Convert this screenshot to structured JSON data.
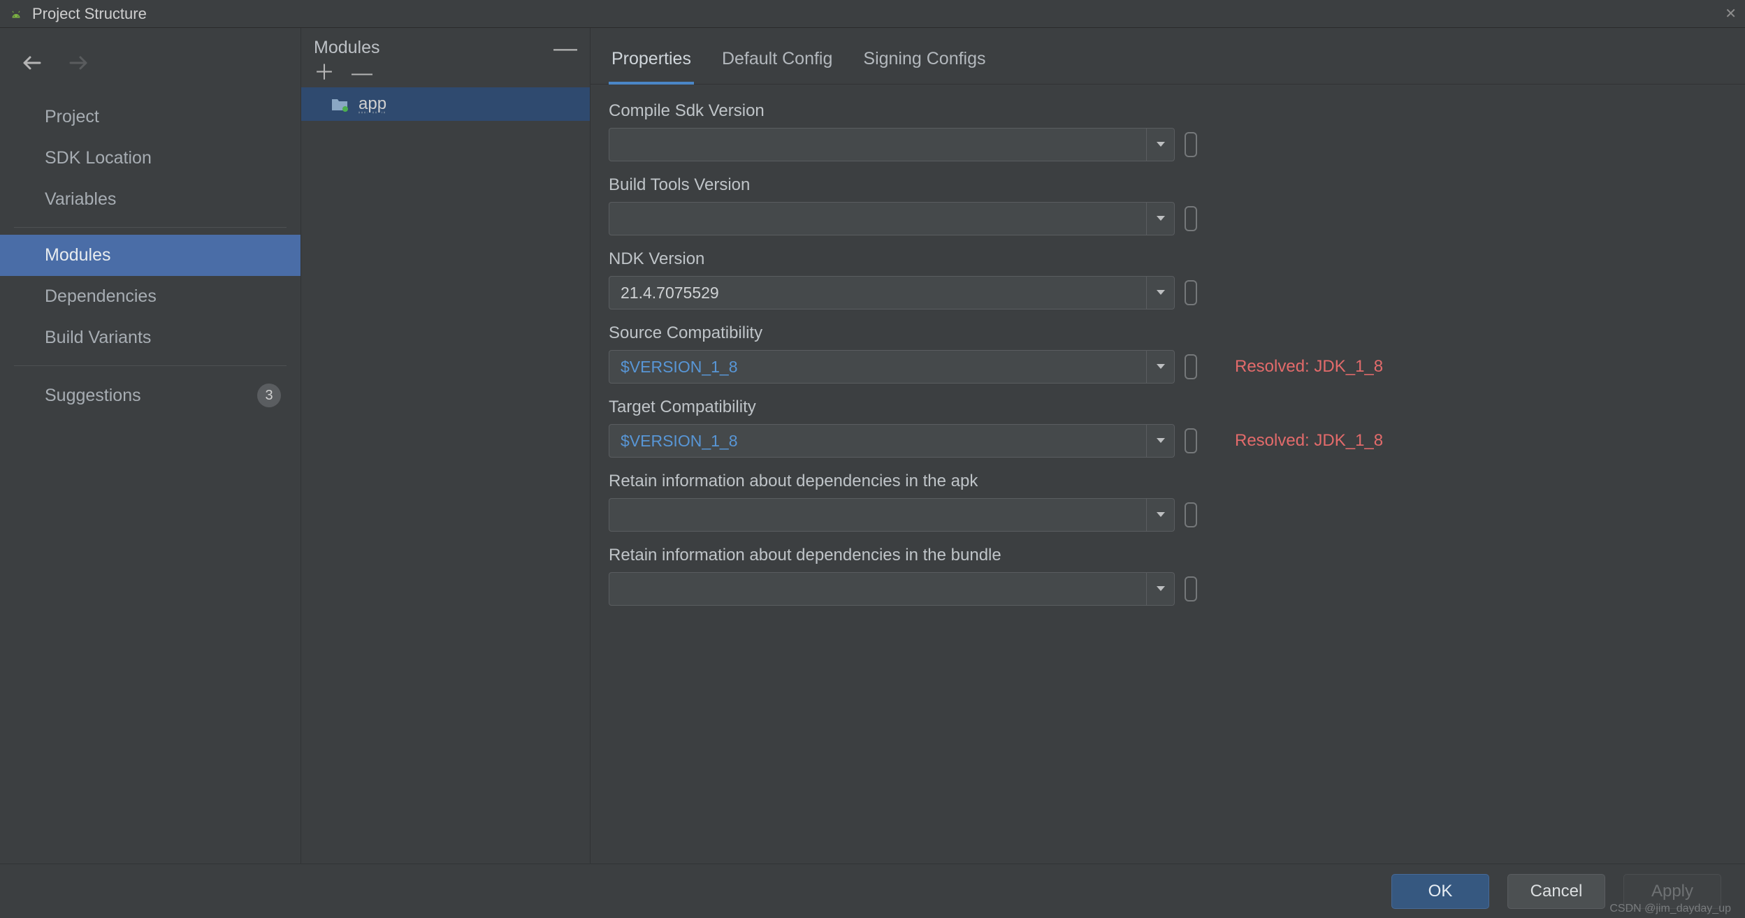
{
  "window": {
    "title": "Project Structure"
  },
  "sidebar": {
    "items": [
      {
        "label": "Project"
      },
      {
        "label": "SDK Location"
      },
      {
        "label": "Variables"
      },
      {
        "label": "Modules"
      },
      {
        "label": "Dependencies"
      },
      {
        "label": "Build Variants"
      },
      {
        "label": "Suggestions"
      }
    ],
    "suggestionsBadge": "3"
  },
  "modules": {
    "header": "Modules",
    "items": [
      {
        "label": "app"
      }
    ]
  },
  "tabs": [
    {
      "label": "Properties"
    },
    {
      "label": "Default Config"
    },
    {
      "label": "Signing Configs"
    }
  ],
  "fields": {
    "compileSdk": {
      "label": "Compile Sdk Version",
      "value": ""
    },
    "buildTools": {
      "label": "Build Tools Version",
      "value": ""
    },
    "ndk": {
      "label": "NDK Version",
      "value": "21.4.7075529"
    },
    "sourceCompat": {
      "label": "Source Compatibility",
      "value": "$VERSION_1_8",
      "resolved": "Resolved: JDK_1_8"
    },
    "targetCompat": {
      "label": "Target Compatibility",
      "value": "$VERSION_1_8",
      "resolved": "Resolved: JDK_1_8"
    },
    "retainApk": {
      "label": "Retain information about dependencies in the apk",
      "value": ""
    },
    "retainBundle": {
      "label": "Retain information about dependencies in the bundle",
      "value": ""
    }
  },
  "footer": {
    "ok": "OK",
    "cancel": "Cancel",
    "apply": "Apply"
  },
  "watermark": "CSDN @jim_dayday_up"
}
